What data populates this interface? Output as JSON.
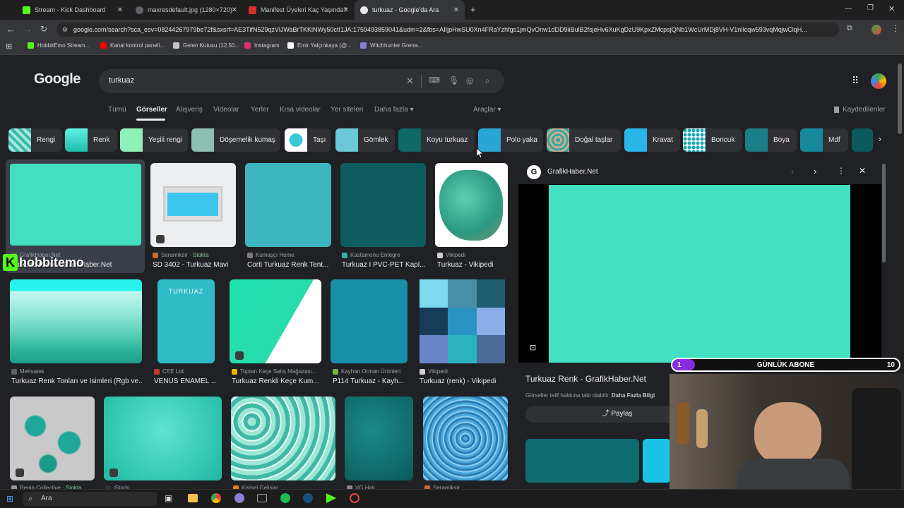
{
  "tabs": [
    {
      "title": "Stream - Kick Dashboard",
      "color": "#53fc18"
    },
    {
      "title": "maxresdefault.jpg (1280×720)",
      "color": "#9aa0a6"
    },
    {
      "title": "Manifest Üyeleri Kaç Yaşında? ",
      "color": "#d93025"
    },
    {
      "title": "turkuaz - Google'da Ara",
      "color": "#e8eaed"
    }
  ],
  "address_url": "google.com/search?sca_esv=08244267979be72f&sxsrf=AE3TifN529qzVlJWaBrTKKiNWy50ctI1JA:1759493859041&udm=2&fbs=AIIjpHwSU0Xn4FRaYzhfgs1jmQvOnw1dDD9iiBulB2fsjeHv6XuKgDzU9KpxZMcpsjQNb1WcUrMDj8VH-V1nIlcqw593vqMqjwClqH...",
  "bookmarks": [
    {
      "label": "HobbitEmo Stream...",
      "color": "#53fc18"
    },
    {
      "label": "Kanal kontrol paneli...",
      "color": "#ff0000"
    },
    {
      "label": "Gelen Kutusu (12.50...",
      "color": "#c5c5c5"
    },
    {
      "label": "Instagram",
      "color": "#e1306c"
    },
    {
      "label": "Emir Yalçınkaya (@...",
      "color": "#ffffff"
    },
    {
      "label": "Witchhunter Grena...",
      "color": "#8a7fd0"
    }
  ],
  "google": {
    "logo": "Google",
    "query": "turkuaz",
    "nav": [
      "Tümü",
      "Görseller",
      "Alışveriş",
      "Videolar",
      "Yerler",
      "Kısa videolar",
      "Yer siteleri",
      "Daha fazla ▾"
    ],
    "tools": "Araçlar ▾",
    "saved": "Kaydedilenler",
    "chips": [
      "Rengi",
      "Renk",
      "Yeşili rengi",
      "Döşemelik kumaş",
      "Taşı",
      "Gömlek",
      "Koyu turkuaz",
      "Polo yaka",
      "Doğal taşlar",
      "Kravat",
      "Boncuk",
      "Boya",
      "Mdf"
    ],
    "results": [
      {
        "source": "GrafikHaber.Net",
        "title": "Turkuaz Renk - GrafikHaber.Net",
        "stock": ""
      },
      {
        "source": "Seramiksir",
        "title": "SD 3402 - Turkuaz Mavi",
        "stock": "Stokta"
      },
      {
        "source": "Kumaşçı Home",
        "title": "Corti Turkuaz Renk Tent...",
        "stock": ""
      },
      {
        "source": "Kastamonu Entegre",
        "title": "Turkuaz I PVC-PET Kapl...",
        "stock": ""
      },
      {
        "source": "Vikipedi",
        "title": "Turkuaz - Vikipedi",
        "stock": ""
      },
      {
        "source": "Mehsatek",
        "title": "Turkuaz Renk Tonları ve İsimleri (Rgb ve...",
        "stock": ""
      },
      {
        "source": "CEE Ltd.",
        "title": "VENÜS ENAMEL ...",
        "stock": ""
      },
      {
        "source": "Toptan Keçe Satış Mağazası...",
        "title": "Turkuaz Renkli Keçe Kum...",
        "stock": ""
      },
      {
        "source": "Kayhan Orman Ürünleri",
        "title": "P114 Turkuaz - Kayh...",
        "stock": ""
      },
      {
        "source": "Vikipedi",
        "title": "Turkuaz (renk) - Vikipedi",
        "stock": ""
      },
      {
        "source": "Regin Collective",
        "title": "",
        "stock": "Stokta"
      },
      {
        "source": "iStock",
        "title": "",
        "stock": ""
      },
      {
        "source": "Kişisel Gelişim",
        "title": "",
        "stock": ""
      },
      {
        "source": "VG Halı",
        "title": "",
        "stock": ""
      },
      {
        "source": "Seramiksir",
        "title": "",
        "stock": ""
      }
    ],
    "turkuaz_label": "TURKUAZ",
    "panel": {
      "site": "GrafikHaber.Net",
      "title": "Turkuaz Renk - GrafikHaber.Net",
      "note": "Görseller telif hakkına tabi olabilir.",
      "more": "Daha Fazla Bilgi",
      "share": "Paylaş",
      "color": "#40e0c0"
    }
  },
  "stream": {
    "watermark": "hobbitemo",
    "watermark_k": "K",
    "sub_goal_label": "GÜNLÜK ABONE",
    "sub_current": "1",
    "sub_target": "10",
    "sub_progress": 0.1
  },
  "taskbar": {
    "search": "Ara"
  }
}
